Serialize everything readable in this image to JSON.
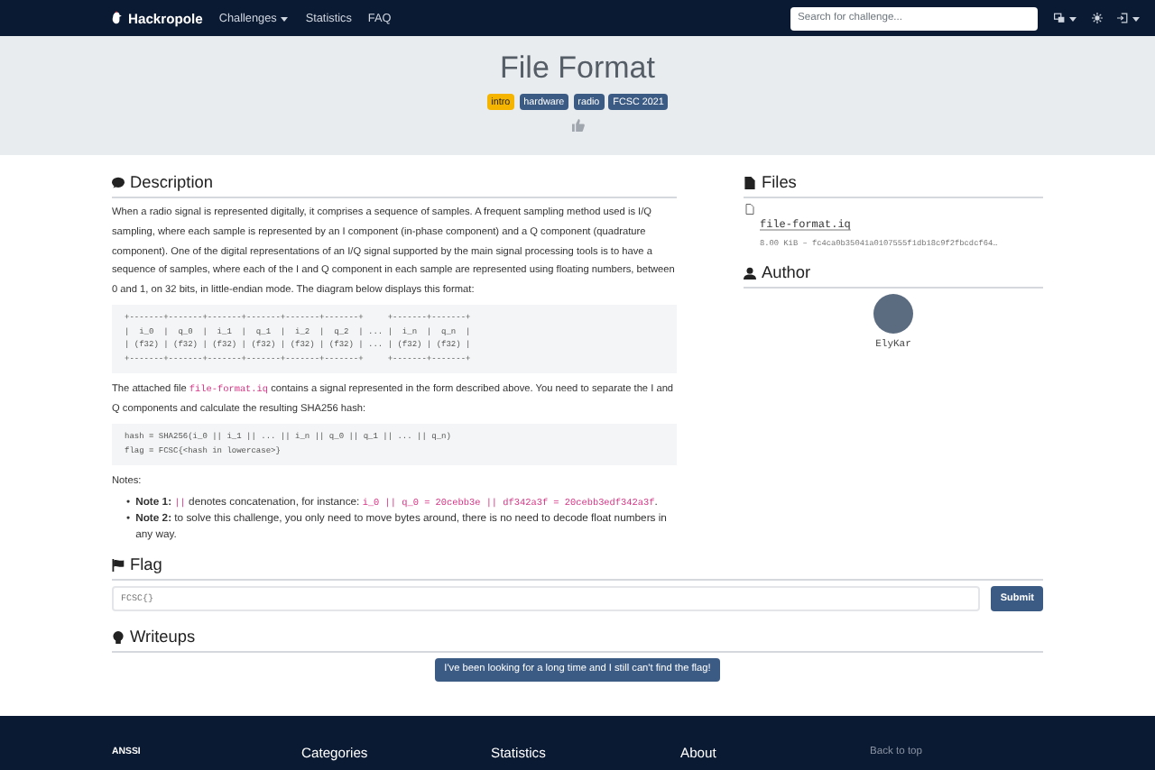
{
  "nav": {
    "brand": "Hackropole",
    "links": [
      {
        "label": "Challenges",
        "dropdown": true
      },
      {
        "label": "Statistics",
        "dropdown": false
      },
      {
        "label": "FAQ",
        "dropdown": false
      }
    ],
    "search": {
      "placeholder": "Search for challenge..."
    }
  },
  "challenge": {
    "title": "File Format",
    "tags": [
      {
        "label": "intro",
        "kind": "difficulty"
      },
      {
        "label": "hardware",
        "kind": "category"
      },
      {
        "label": "radio",
        "kind": "category"
      },
      {
        "label": "FCSC 2021",
        "kind": "category"
      }
    ]
  },
  "description": {
    "heading": "Description",
    "blocks": [
      {
        "kind": "para",
        "parts": [
          {
            "kind": "text",
            "text": "When a radio signal is represented digitally, it comprises a sequence of samples. A frequent sampling method used is I/Q sampling, where each sample is represented by an I component (in-phase component) and a Q component (quadrature component). One of the digital representations of an I/Q signal supported by the main signal processing tools is to have a sequence of samples, where each of the I and Q component in each sample are represented using floating numbers, between 0 and 1, on 32 bits, in little-endian mode. The diagram below displays this format:"
          }
        ]
      },
      {
        "kind": "pre",
        "text": "+-------+-------+-------+-------+-------+-------+     +-------+-------+\n|  i_0  |  q_0  |  i_1  |  q_1  |  i_2  |  q_2  | ... |  i_n  |  q_n  |\n| (f32) | (f32) | (f32) | (f32) | (f32) | (f32) | ... | (f32) | (f32) |\n+-------+-------+-------+-------+-------+-------+     +-------+-------+"
      },
      {
        "kind": "para",
        "parts": [
          {
            "kind": "text",
            "text": "The attached file "
          },
          {
            "kind": "code",
            "text": "file-format.iq"
          },
          {
            "kind": "text",
            "text": " contains a signal represented in the form described above. You need to separate the I and Q components and calculate the resulting SHA256 hash:"
          }
        ]
      },
      {
        "kind": "pre",
        "text": "hash = SHA256(i_0 || i_1 || ... || i_n || q_0 || q_1 || ... || q_n)\nflag = FCSC{<hash in lowercase>}"
      },
      {
        "kind": "para",
        "parts": [
          {
            "kind": "text",
            "text": "Notes:"
          }
        ]
      },
      {
        "kind": "list",
        "items": [
          {
            "marker": "•",
            "parts": [
              {
                "kind": "text",
                "text": "**Note 1:** "
              },
              {
                "kind": "code",
                "text": "||"
              },
              {
                "kind": "text",
                "text": " denotes concatenation, for instance: "
              },
              {
                "kind": "code",
                "text": "i_0 || q_0 = 20cebb3e || df342a3f = 20cebb3edf342a3f"
              },
              {
                "kind": "text",
                "text": "."
              }
            ]
          },
          {
            "marker": "•",
            "parts": [
              {
                "kind": "text",
                "text": "**Note 2:** to solve this challenge, you only need to move bytes around, there is no need to decode float numbers in any way."
              }
            ]
          }
        ]
      }
    ]
  },
  "files": {
    "heading": "Files",
    "items": [
      {
        "name": "file-format.iq",
        "info": "8.00 KiB – fc4ca0b35041a0107555f1db18c9f2fbcdcf64…"
      }
    ]
  },
  "author": {
    "heading": "Author",
    "name": "ElyKar"
  },
  "flag": {
    "heading": "Flag",
    "placeholder": "FCSC{}",
    "button": "Submit"
  },
  "writeups": {
    "heading": "Writeups",
    "button": "I've been looking for a long time and I still can't find the flag!"
  },
  "footer": {
    "columns": [
      {
        "text": "ANSSI",
        "kind": "org"
      },
      {
        "text": "Categories",
        "kind": "heading"
      },
      {
        "text": "Statistics",
        "kind": "heading"
      },
      {
        "text": "About",
        "kind": "heading"
      },
      {
        "text": "Back to top",
        "kind": "link"
      }
    ]
  }
}
